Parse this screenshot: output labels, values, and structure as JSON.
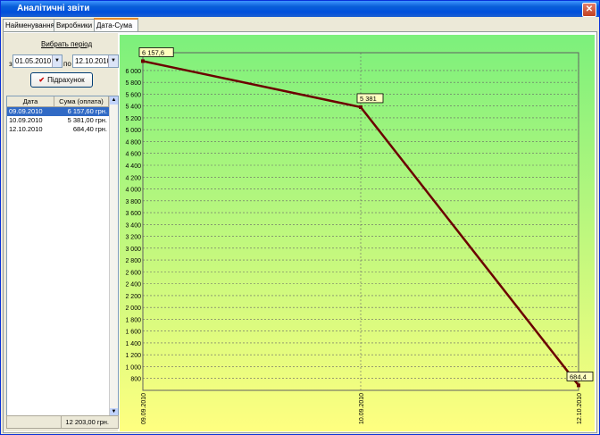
{
  "window": {
    "title": "Аналітичні звіти",
    "close_glyph": "✕"
  },
  "tabs": [
    {
      "label": "Найменування",
      "active": false
    },
    {
      "label": "Виробники",
      "active": false
    },
    {
      "label": "Дата-Сума",
      "active": true
    }
  ],
  "filter": {
    "period_label": "Вибрать період",
    "from_prefix": "з",
    "from_date": "01.05.2010",
    "to_prefix": "по",
    "to_date": "12.10.2010",
    "calc_label": "Підрахунок"
  },
  "table": {
    "columns": [
      "Дата",
      "Сума (оплата)"
    ],
    "rows": [
      {
        "date": "09.09.2010",
        "sum": "6 157,60 грн.",
        "selected": true
      },
      {
        "date": "10.09.2010",
        "sum": "5 381,00 грн.",
        "selected": false
      },
      {
        "date": "12.10.2010",
        "sum": "684,40 грн.",
        "selected": false
      }
    ],
    "total": "12 203,00 грн."
  },
  "colors": {
    "chart_top": "#7cf07c",
    "chart_bottom": "#ffff80",
    "line": "#6b0000",
    "label_bg": "#ffffc0",
    "selection": "#316ac5"
  },
  "chart_data": {
    "type": "line",
    "x": [
      "09.09.2010",
      "10.09.2010",
      "12.10.2010"
    ],
    "series": [
      {
        "values": [
          6157.6,
          5381,
          684.4
        ]
      }
    ],
    "data_labels": [
      "6 157,6",
      "5 381",
      "684,4"
    ],
    "ylim": [
      600,
      6300
    ],
    "yticks": [
      800,
      1000,
      1200,
      1400,
      1600,
      1800,
      2000,
      2200,
      2400,
      2600,
      2800,
      3000,
      3200,
      3400,
      3600,
      3800,
      4000,
      4200,
      4400,
      4600,
      4800,
      5000,
      5200,
      5400,
      5600,
      5800,
      6000
    ],
    "ytick_labels": [
      "800",
      "1 000",
      "1 200",
      "1 400",
      "1 600",
      "1 800",
      "2 000",
      "2 200",
      "2 400",
      "2 600",
      "2 800",
      "3 000",
      "3 200",
      "3 400",
      "3 600",
      "3 800",
      "4 000",
      "4 200",
      "4 400",
      "4 600",
      "4 800",
      "5 000",
      "5 200",
      "5 400",
      "5 600",
      "5 800",
      "6 000"
    ],
    "grid": true,
    "title": "",
    "xlabel": "",
    "ylabel": ""
  }
}
